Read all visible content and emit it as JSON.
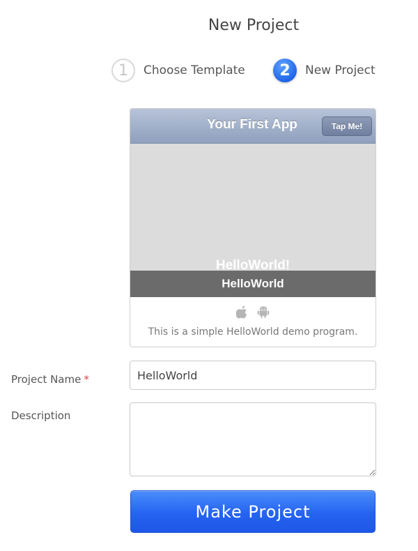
{
  "header": {
    "title": "New Project"
  },
  "steps": [
    {
      "number": "1",
      "label": "Choose Template",
      "active": false
    },
    {
      "number": "2",
      "label": "New Project",
      "active": true
    }
  ],
  "template_card": {
    "preview": {
      "navbar_title": "Your First App",
      "nav_button_label": "Tap Me!",
      "body_text": "HelloWorld!"
    },
    "name": "HelloWorld",
    "platform_icons": [
      "apple-icon",
      "android-icon"
    ],
    "description": "This is a simple HelloWorld demo program."
  },
  "form": {
    "project_name": {
      "label": "Project Name",
      "required_mark": "*",
      "value": "HelloWorld"
    },
    "description": {
      "label": "Description",
      "value": ""
    },
    "submit_label": "Make Project"
  },
  "colors": {
    "accent": "#2563f1",
    "navbar": "#9aa9c4",
    "name_bar": "#6b6b6b",
    "required": "#e24040"
  }
}
